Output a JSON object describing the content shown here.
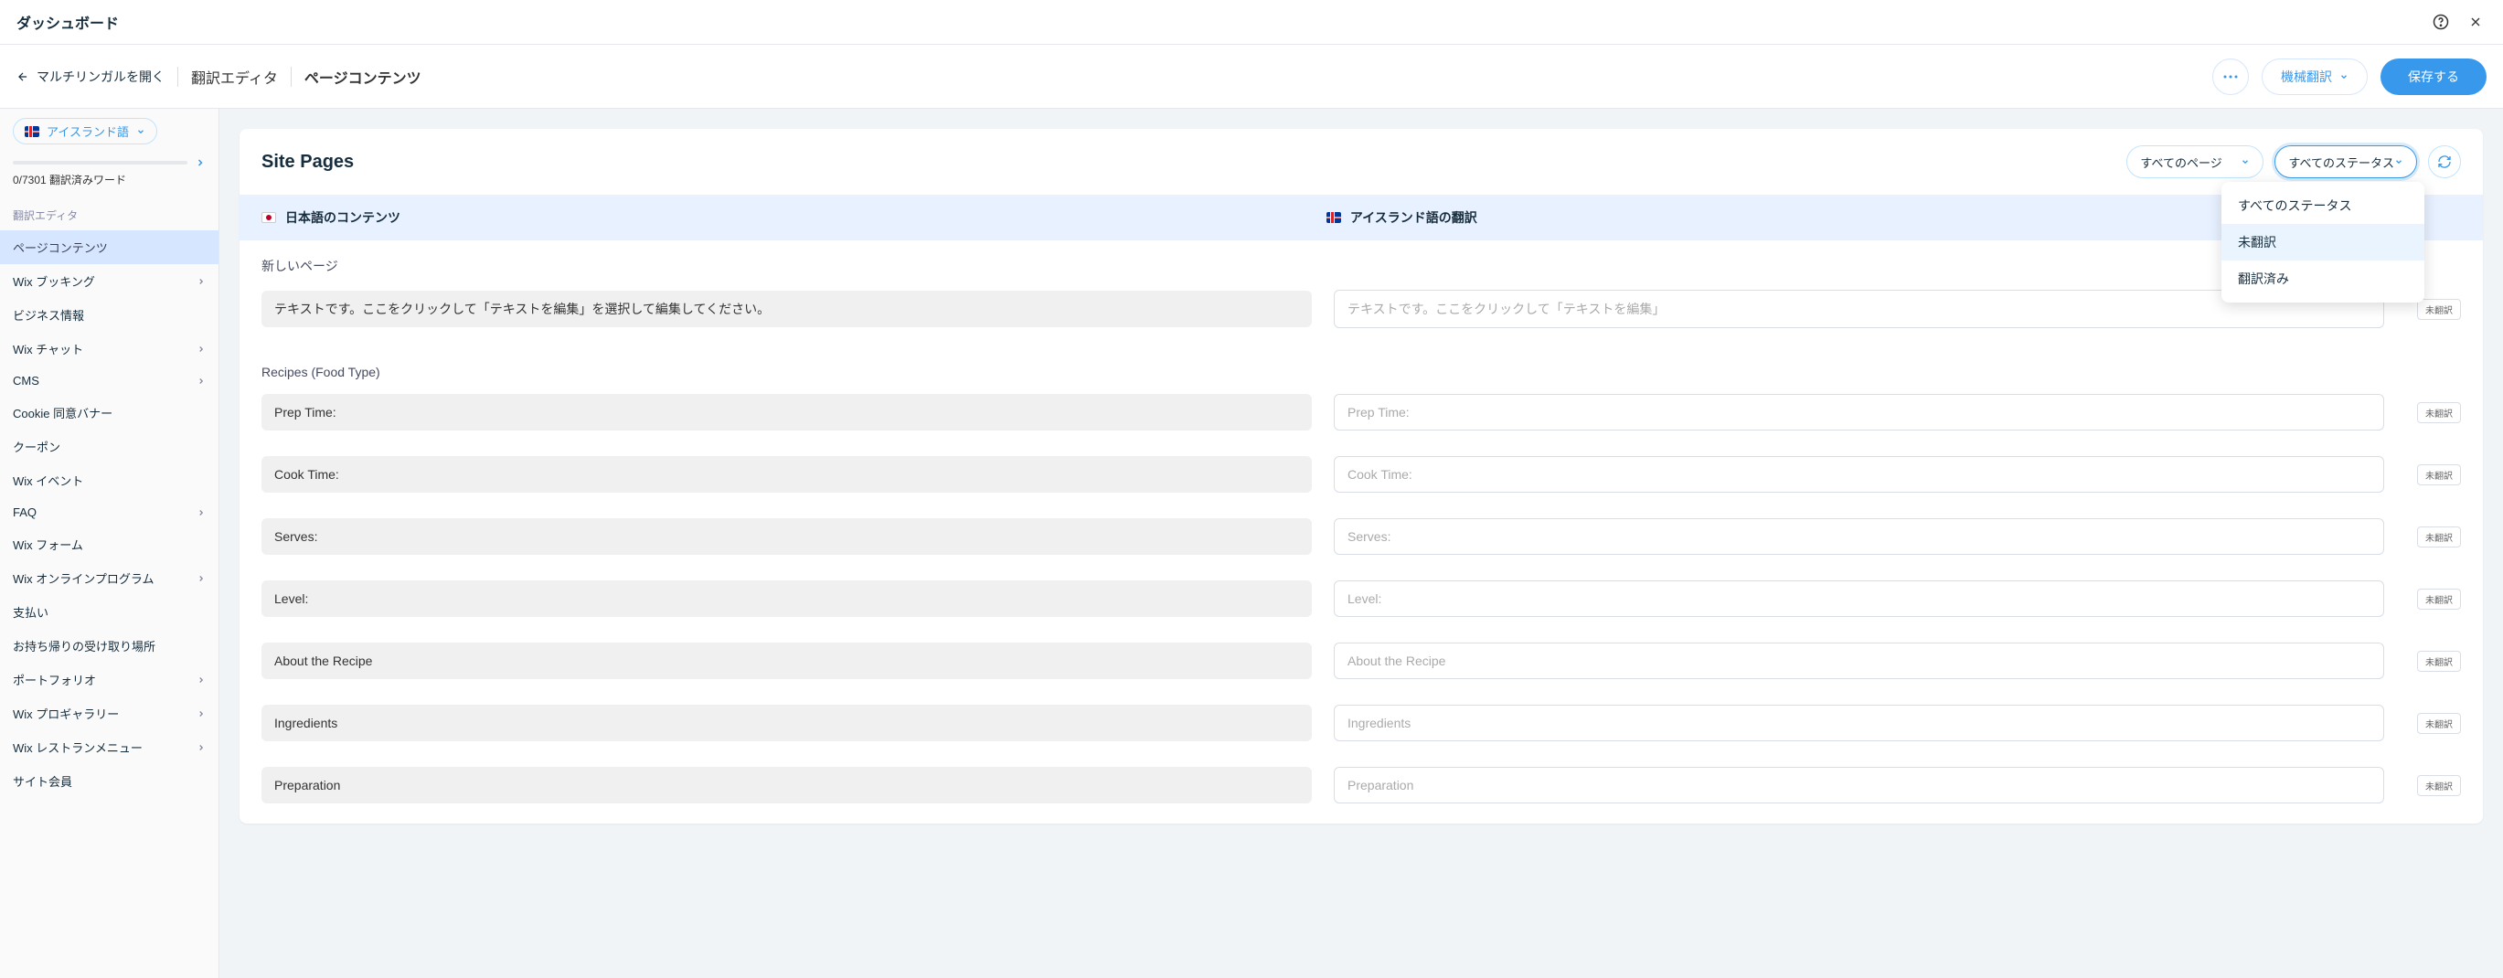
{
  "topbar": {
    "title": "ダッシュボード"
  },
  "actionbar": {
    "back": "マルチリンガルを開く",
    "crumb1": "翻訳エディタ",
    "crumb2": "ページコンテンツ",
    "machine": "機械翻訳",
    "save": "保存する"
  },
  "sidebar": {
    "language": "アイスランド語",
    "progress": "0/7301 翻訳済みワード",
    "section": "翻訳エディタ",
    "items": [
      {
        "label": "ページコンテンツ",
        "active": true,
        "chevron": false
      },
      {
        "label": "Wix ブッキング",
        "active": false,
        "chevron": true
      },
      {
        "label": "ビジネス情報",
        "active": false,
        "chevron": false
      },
      {
        "label": "Wix チャット",
        "active": false,
        "chevron": true
      },
      {
        "label": "CMS",
        "active": false,
        "chevron": true
      },
      {
        "label": "Cookie 同意バナー",
        "active": false,
        "chevron": false
      },
      {
        "label": "クーポン",
        "active": false,
        "chevron": false
      },
      {
        "label": "Wix イベント",
        "active": false,
        "chevron": false
      },
      {
        "label": "FAQ",
        "active": false,
        "chevron": true
      },
      {
        "label": "Wix フォーム",
        "active": false,
        "chevron": false
      },
      {
        "label": "Wix オンラインプログラム",
        "active": false,
        "chevron": true
      },
      {
        "label": "支払い",
        "active": false,
        "chevron": false
      },
      {
        "label": "お持ち帰りの受け取り場所",
        "active": false,
        "chevron": false
      },
      {
        "label": "ポートフォリオ",
        "active": false,
        "chevron": true
      },
      {
        "label": "Wix プロギャラリー",
        "active": false,
        "chevron": true
      },
      {
        "label": "Wix レストランメニュー",
        "active": false,
        "chevron": true
      },
      {
        "label": "サイト会員",
        "active": false,
        "chevron": false
      }
    ]
  },
  "panel": {
    "title": "Site Pages",
    "pageFilter": "すべてのページ",
    "statusFilter": "すべてのステータス",
    "colSrc": "日本語のコンテンツ",
    "colDst": "アイスランド語の翻訳"
  },
  "dropdown": {
    "opt1": "すべてのステータス",
    "opt2": "未翻訳",
    "opt3": "翻訳済み"
  },
  "sections": [
    {
      "label": "新しいページ",
      "rows": [
        {
          "src": "テキストです。ここをクリックして「テキストを編集」を選択して編集してください。",
          "dst": "テキストです。ここをクリックして「テキストを編集」",
          "status": "未翻訳"
        }
      ]
    },
    {
      "label": "Recipes (Food Type)",
      "rows": [
        {
          "src": "Prep Time:",
          "dst": "Prep Time:",
          "status": "未翻訳"
        },
        {
          "src": "Cook Time:",
          "dst": "Cook Time:",
          "status": "未翻訳"
        },
        {
          "src": "Serves:",
          "dst": "Serves:",
          "status": "未翻訳"
        },
        {
          "src": "Level:",
          "dst": "Level:",
          "status": "未翻訳"
        },
        {
          "src": "About the Recipe",
          "dst": "About the Recipe",
          "status": "未翻訳"
        },
        {
          "src": "Ingredients",
          "dst": "Ingredients",
          "status": "未翻訳"
        },
        {
          "src": "Preparation",
          "dst": "Preparation",
          "status": "未翻訳"
        }
      ]
    }
  ]
}
